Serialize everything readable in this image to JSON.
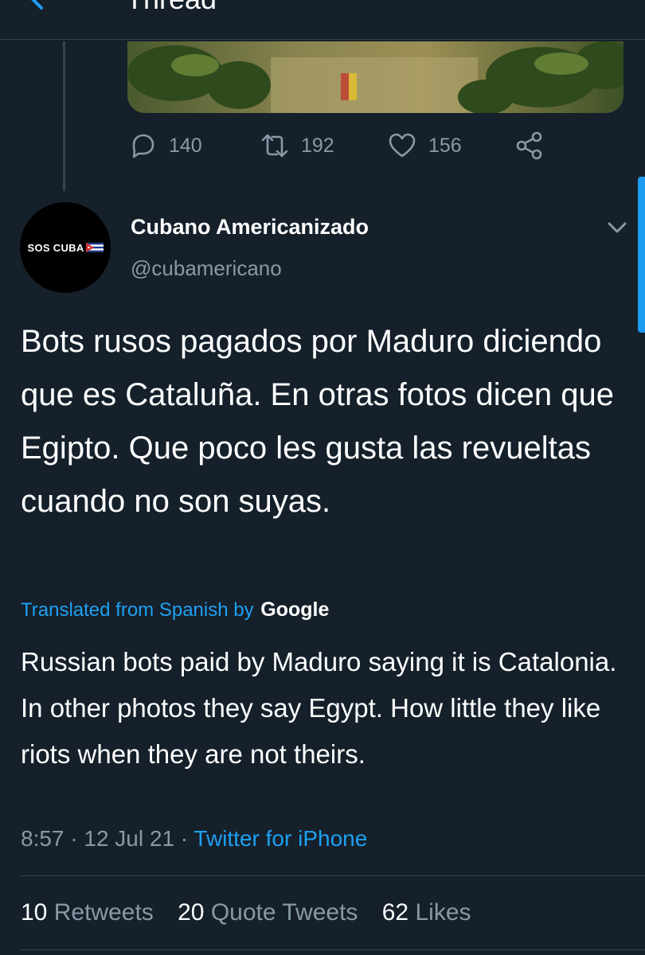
{
  "header": {
    "title": "Thread"
  },
  "previous_tweet": {
    "actions": {
      "replies": "140",
      "retweets": "192",
      "likes": "156"
    }
  },
  "tweet": {
    "avatar_text": "SOS CUBA",
    "display_name": "Cubano Americanizado",
    "handle": "@cubamericano",
    "text": "Bots rusos pagados por Maduro diciendo que es Cataluña. En otras fotos dicen que Egipto. Que poco les gusta las revueltas cuando no son suyas.",
    "translated_label": "Translated from Spanish by",
    "translator": "Google",
    "translation": "Russian bots paid by Maduro saying it is Catalonia. In other photos they say Egypt. How little they like riots when they are not theirs.",
    "time": "8:57 · 12 Jul 21 ·",
    "source": "Twitter for iPhone"
  },
  "stats": {
    "retweets_count": "10",
    "retweets_label": "Retweets",
    "quotes_count": "20",
    "quotes_label": "Quote Tweets",
    "likes_count": "62",
    "likes_label": "Likes"
  },
  "colors": {
    "background": "#15202b",
    "accent": "#1da1f2",
    "muted": "#8899a6",
    "border": "#38444d"
  }
}
